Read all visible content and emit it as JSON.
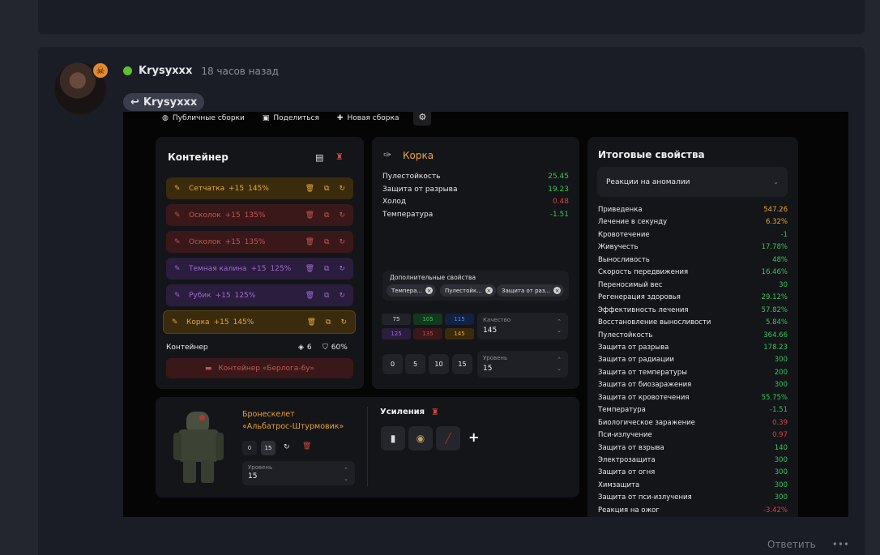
{
  "post": {
    "username": "Krysyxxx",
    "time": "18 часов назад",
    "reply_to": "Krysyxxx",
    "reply_label": "Ответить",
    "more_label": "•••",
    "status_color": "#5fc031"
  },
  "builder": {
    "topbar": {
      "public": "Публичные сборки",
      "share": "Поделиться",
      "new": "Новая сборка"
    },
    "container": {
      "title": "Контейнер",
      "slots": [
        {
          "name": "Сетчатка",
          "lvl": "+15",
          "pct": "145%",
          "tone": "gold"
        },
        {
          "name": "Осколок",
          "lvl": "+15",
          "pct": "135%",
          "tone": "red"
        },
        {
          "name": "Осколок",
          "lvl": "+15",
          "pct": "135%",
          "tone": "red"
        },
        {
          "name": "Темная калина",
          "lvl": "+15",
          "pct": "125%",
          "tone": "purple"
        },
        {
          "name": "Рубик",
          "lvl": "+15",
          "pct": "125%",
          "tone": "purple"
        },
        {
          "name": "Корка",
          "lvl": "+15",
          "pct": "145%",
          "tone": "gold"
        }
      ],
      "footer_label": "Контейнер",
      "slots_count": "6",
      "protection": "60%",
      "container_name": "Контейнер «Берлога-6у»"
    },
    "item": {
      "title": "Корка",
      "stats": [
        {
          "k": "Пулестойкость",
          "v": "25.45",
          "c": "green"
        },
        {
          "k": "Защита от разрыва",
          "v": "19.23",
          "c": "green"
        },
        {
          "k": "Холод",
          "v": "0.48",
          "c": "redv"
        },
        {
          "k": "Температура",
          "v": "-1.51",
          "c": "green"
        }
      ],
      "extra_label": "Дополнительные свойства",
      "chips": [
        "Темпера...",
        "Пулестойк...",
        "Защита от раз..."
      ],
      "quality_cells": [
        "75",
        "105",
        "115",
        "125",
        "135",
        "145"
      ],
      "quality_label": "Качество",
      "quality_value": "145",
      "levels": [
        "0",
        "5",
        "10",
        "15"
      ],
      "level_label": "Уровень",
      "level_value": "15"
    },
    "props": {
      "title": "Итоговые свойства",
      "dropdown": "Реакции на аномалии",
      "rows": [
        {
          "k": "Приведенка",
          "v": "547.26",
          "c": "orange"
        },
        {
          "k": "Лечение в секунду",
          "v": "6.32%",
          "c": "orange"
        },
        {
          "k": "Кровотечение",
          "v": "-1",
          "c": "green"
        },
        {
          "k": "Живучесть",
          "v": "17.78%",
          "c": "green"
        },
        {
          "k": "Выносливость",
          "v": "48%",
          "c": "green"
        },
        {
          "k": "Скорость передвижения",
          "v": "16.46%",
          "c": "green"
        },
        {
          "k": "Переносимый вес",
          "v": "30",
          "c": "green"
        },
        {
          "k": "Регенерация здоровья",
          "v": "29.12%",
          "c": "green"
        },
        {
          "k": "Эффективность лечения",
          "v": "57.82%",
          "c": "green"
        },
        {
          "k": "Восстановление выносливости",
          "v": "5.84%",
          "c": "green"
        },
        {
          "k": "Пулестойкость",
          "v": "364.66",
          "c": "green"
        },
        {
          "k": "Защита от разрыва",
          "v": "178.23",
          "c": "green"
        },
        {
          "k": "Защита от радиации",
          "v": "300",
          "c": "green"
        },
        {
          "k": "Защита от температуры",
          "v": "200",
          "c": "green"
        },
        {
          "k": "Защита от биозаражения",
          "v": "300",
          "c": "green"
        },
        {
          "k": "Защита от кровотечения",
          "v": "55.75%",
          "c": "green"
        },
        {
          "k": "Температура",
          "v": "-1.51",
          "c": "green"
        },
        {
          "k": "Биологическое заражение",
          "v": "0.39",
          "c": "redv"
        },
        {
          "k": "Пси-излучение",
          "v": "0.97",
          "c": "redv"
        },
        {
          "k": "Защита от взрыва",
          "v": "140",
          "c": "green"
        },
        {
          "k": "Электрозащита",
          "v": "300",
          "c": "green"
        },
        {
          "k": "Защита от огня",
          "v": "300",
          "c": "green"
        },
        {
          "k": "Химзащита",
          "v": "300",
          "c": "green"
        },
        {
          "k": "Защита от пси-излучения",
          "v": "300",
          "c": "green"
        },
        {
          "k": "Реакция на ожог",
          "v": "-3.42%",
          "c": "redv"
        }
      ]
    },
    "armor": {
      "name_line1": "Бронескелет",
      "name_line2": "«Альбатрос-Штурмовик»",
      "btn0": "0",
      "btn15": "15",
      "level_label": "Уровень",
      "level_value": "15",
      "boost_title": "Усиления",
      "add": "+"
    }
  }
}
